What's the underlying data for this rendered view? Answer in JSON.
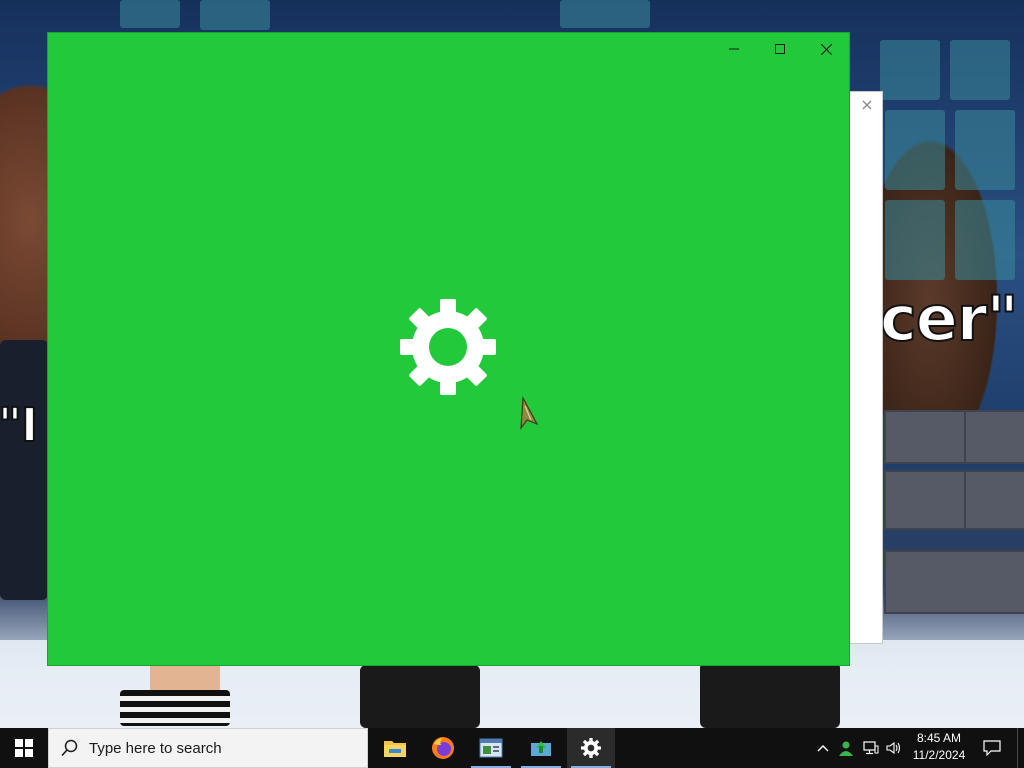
{
  "wallpaper": {
    "text": "cer\"",
    "text_left": "\"I"
  },
  "background_window": {
    "close_glyph": "×"
  },
  "app_window": {
    "background": "#22c93a",
    "splash_icon": "gear-icon",
    "caption": {
      "minimize_icon": "minimize-icon",
      "maximize_icon": "maximize-icon",
      "close_icon": "close-icon"
    }
  },
  "taskbar": {
    "start_icon": "windows-logo-icon",
    "search": {
      "placeholder": "Type here to search"
    },
    "apps": [
      {
        "name": "File Explorer",
        "icon": "folder-icon",
        "running": false
      },
      {
        "name": "Firefox",
        "icon": "firefox-icon",
        "running": false
      },
      {
        "name": "App",
        "icon": "window-app-icon",
        "running": true
      },
      {
        "name": "App",
        "icon": "green-app-icon",
        "running": true
      },
      {
        "name": "Settings",
        "icon": "gear-icon",
        "running": true,
        "active": true
      }
    ],
    "tray": {
      "chevron_icon": "chevron-up-icon",
      "user_icon": "person-icon",
      "network_icon": "network-icon",
      "volume_icon": "volume-icon"
    },
    "clock": {
      "time": "8:45 AM",
      "date": "11/2/2024"
    },
    "notification_icon": "notification-icon"
  }
}
